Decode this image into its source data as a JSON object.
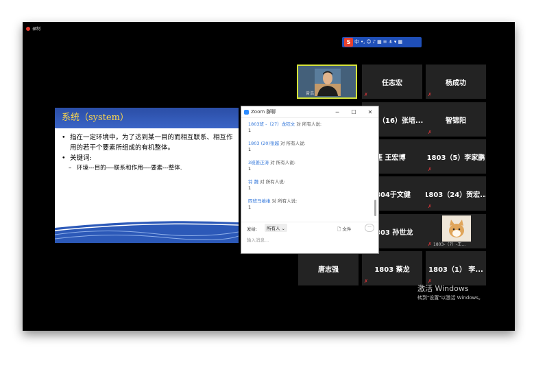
{
  "recording": {
    "label": "录制"
  },
  "ime_toolbar": {
    "logo": "S",
    "items": [
      "中",
      "•,",
      "☺",
      "♪",
      "▦",
      "≡",
      "⚓",
      "▾",
      "▦"
    ]
  },
  "self_video": {
    "name": "曾浩"
  },
  "participants": [
    "任志宏",
    "杨成功",
    "（16）张培...",
    "智锦阳",
    "班 王宏博",
    "1803（5）李家鹏",
    "804于文健",
    "1803（24）贺宏...",
    "303 孙世龙",
    "1803-（7）-王...",
    "唐志强",
    "1803 蔡龙",
    "1803（1） 李..."
  ],
  "slide": {
    "title": "系统（system）",
    "bullet1": "指在一定环境中，为了达到某一目的而相互联系、相互作用的若干个要素所组成的有机整体。",
    "bullet2": "关键词:",
    "sub1": "环境---目的----联系和作用----要素---整体."
  },
  "chat": {
    "title": "Zoom 群聊",
    "messages": [
      {
        "from": "1803班 -（27）龙钰文",
        "to": "对 所有人说:",
        "text": "1"
      },
      {
        "from": "1803 (20)张越",
        "to": "对 所有人说:",
        "text": "1"
      },
      {
        "from": "3班姜正涛",
        "to": "对 所有人说:",
        "text": "1"
      },
      {
        "from": "铃 魏",
        "to": "对 所有人说:",
        "text": "1"
      },
      {
        "from": "四班马维维",
        "to": "对 所有人说:",
        "text": "1"
      }
    ],
    "send_to_label": "发给:",
    "send_to_value": "所有人 ⌄",
    "file_label": "文件",
    "input_placeholder": "输入消息..."
  },
  "watermark": {
    "line1": "激活 Windows",
    "line2": "转到\"设置\"以激活 Windows。"
  }
}
